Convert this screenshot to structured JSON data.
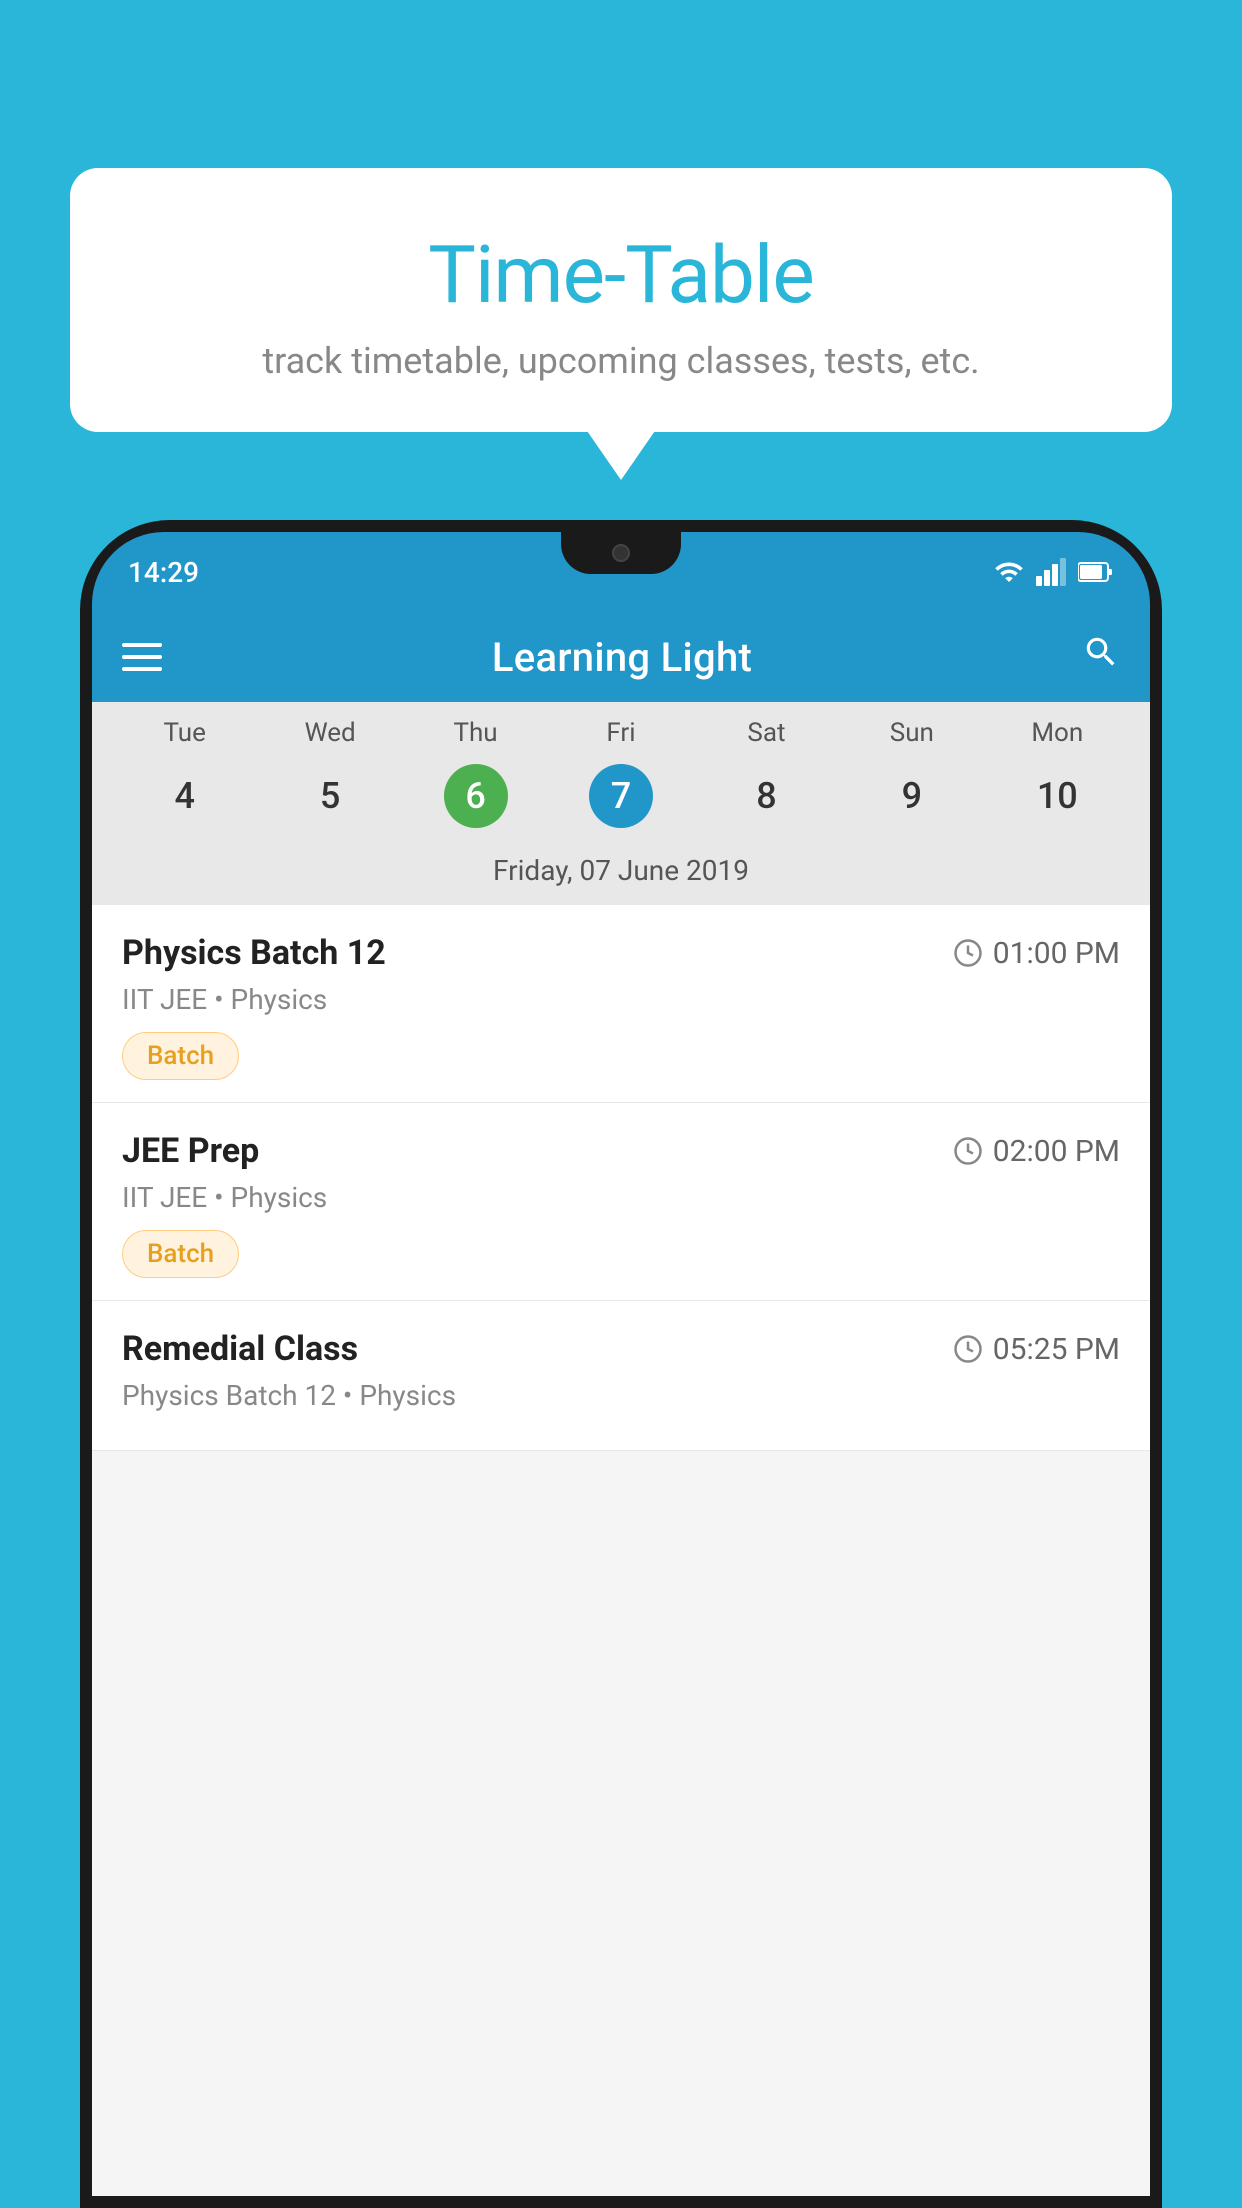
{
  "background_color": "#29B6D8",
  "tooltip": {
    "title": "Time-Table",
    "subtitle": "track timetable, upcoming classes, tests, etc."
  },
  "phone": {
    "status_bar": {
      "time": "14:29",
      "icons": [
        "wifi",
        "signal",
        "battery"
      ]
    },
    "app_header": {
      "title": "Learning Light"
    },
    "calendar": {
      "days": [
        "Tue",
        "Wed",
        "Thu",
        "Fri",
        "Sat",
        "Sun",
        "Mon"
      ],
      "dates": [
        "4",
        "5",
        "6",
        "7",
        "8",
        "9",
        "10"
      ],
      "today_index": 2,
      "selected_index": 3,
      "selected_label": "Friday, 07 June 2019"
    },
    "classes": [
      {
        "name": "Physics Batch 12",
        "time": "01:00 PM",
        "subject": "IIT JEE • Physics",
        "badge": "Batch"
      },
      {
        "name": "JEE Prep",
        "time": "02:00 PM",
        "subject": "IIT JEE • Physics",
        "badge": "Batch"
      },
      {
        "name": "Remedial Class",
        "time": "05:25 PM",
        "subject": "Physics Batch 12 • Physics",
        "badge": null
      }
    ]
  }
}
